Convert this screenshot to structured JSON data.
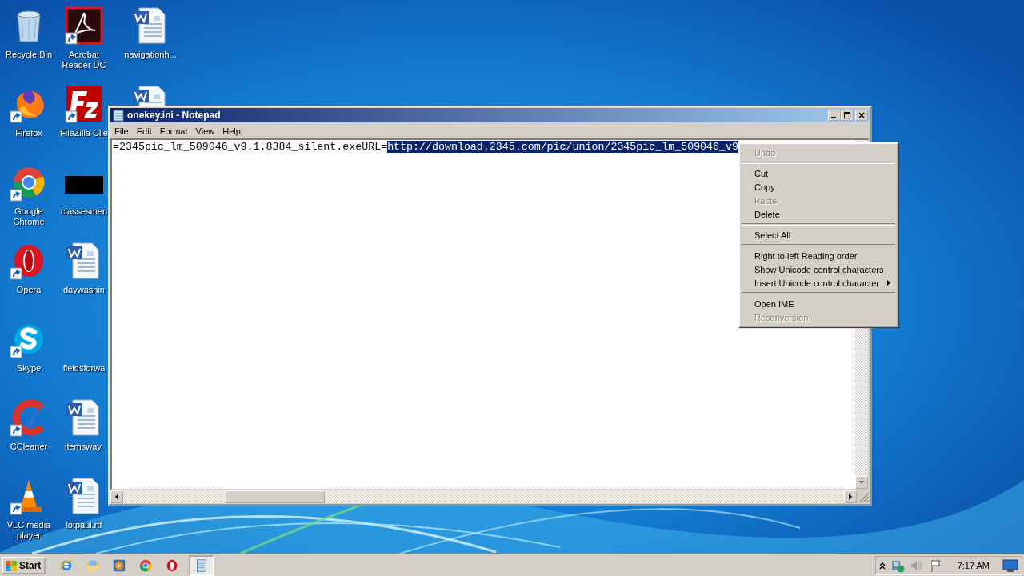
{
  "desktop": {
    "icons": [
      {
        "kind": "recycle",
        "label": "Recycle Bin",
        "shortcut": false
      },
      {
        "kind": "firefox",
        "label": "Firefox",
        "shortcut": true
      },
      {
        "kind": "chrome",
        "label": "Google Chrome",
        "shortcut": true
      },
      {
        "kind": "opera",
        "label": "Opera",
        "shortcut": true
      },
      {
        "kind": "skype",
        "label": "Skype",
        "shortcut": true
      },
      {
        "kind": "ccleaner",
        "label": "CCleaner",
        "shortcut": true
      },
      {
        "kind": "vlc",
        "label": "VLC media player",
        "shortcut": true
      },
      {
        "kind": "acrobat",
        "label": "Acrobat Reader DC",
        "shortcut": true
      },
      {
        "kind": "filezilla",
        "label": "FileZilla Clie",
        "shortcut": true
      },
      {
        "kind": "blackbar",
        "label": "classesmen",
        "shortcut": false
      },
      {
        "kind": "word",
        "label": "daywashin",
        "shortcut": false
      },
      {
        "kind": "blank",
        "label": "fieldsforwa"
      },
      {
        "kind": "word",
        "label": "itemsway.",
        "shortcut": false
      },
      {
        "kind": "word",
        "label": "lotpaul.rtf",
        "shortcut": false
      },
      {
        "kind": "word",
        "label": "navigationh...",
        "shortcut": false
      },
      {
        "kind": "word"
      }
    ]
  },
  "notepad": {
    "title": "onekey.ini - Notepad",
    "menu": [
      "File",
      "Edit",
      "Format",
      "View",
      "Help"
    ],
    "text": {
      "plain": "=2345pic_lm_509046_v9.1.8384_silent.exeURL=",
      "selected": "http://download.2345.com/pic/union/2345pic_lm_509046_v9"
    }
  },
  "context_menu": {
    "items": [
      {
        "kind": "item",
        "label": "Undo",
        "disabled": true,
        "submenu": false
      },
      {
        "kind": "separator"
      },
      {
        "kind": "item",
        "label": "Cut",
        "disabled": false,
        "submenu": false
      },
      {
        "kind": "item",
        "label": "Copy",
        "disabled": false,
        "submenu": false
      },
      {
        "kind": "item",
        "label": "Paste",
        "disabled": true,
        "submenu": false
      },
      {
        "kind": "item",
        "label": "Delete",
        "disabled": false,
        "submenu": false
      },
      {
        "kind": "separator"
      },
      {
        "kind": "item",
        "label": "Select All",
        "disabled": false,
        "submenu": false
      },
      {
        "kind": "separator"
      },
      {
        "kind": "item",
        "label": "Right to left Reading order",
        "disabled": false,
        "submenu": false
      },
      {
        "kind": "item",
        "label": "Show Unicode control characters",
        "disabled": false,
        "submenu": false
      },
      {
        "kind": "item",
        "label": "Insert Unicode control character",
        "disabled": false,
        "submenu": true
      },
      {
        "kind": "separator"
      },
      {
        "kind": "item",
        "label": "Open IME",
        "disabled": false,
        "submenu": false
      },
      {
        "kind": "item",
        "label": "Reconversion",
        "disabled": true,
        "submenu": false
      }
    ]
  },
  "taskbar": {
    "start": "Start",
    "apps": [
      {
        "kind": "ie",
        "active": false
      },
      {
        "kind": "explorer",
        "active": false
      },
      {
        "kind": "media",
        "active": false
      },
      {
        "kind": "chrome",
        "active": false
      },
      {
        "kind": "opera",
        "active": false
      },
      {
        "kind": "notepad",
        "active": true
      }
    ],
    "clock": "7:17 AM"
  }
}
